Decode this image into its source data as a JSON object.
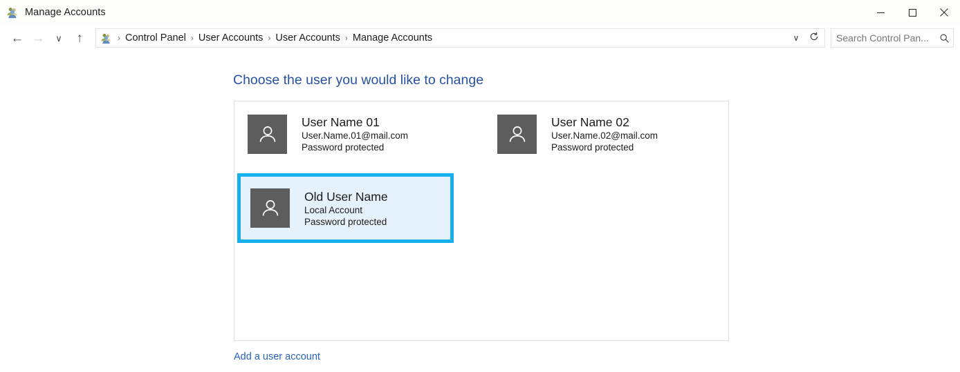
{
  "window": {
    "title": "Manage Accounts",
    "icon": "users-icon",
    "minimize_label": "–",
    "maximize_label": "□",
    "close_label": "×"
  },
  "addressbar": {
    "back_label": "←",
    "forward_label": "→",
    "recent_label": "∨",
    "up_label": "↑",
    "path_icon": "users-icon",
    "breadcrumbs": [
      {
        "label": "Control Panel"
      },
      {
        "label": "User Accounts"
      },
      {
        "label": "User Accounts"
      },
      {
        "label": "Manage Accounts"
      }
    ],
    "separator": "›",
    "dropdown_label": "∨",
    "refresh_label": "refresh-icon",
    "search": {
      "placeholder": "Search Control Pan...",
      "value": "",
      "icon": "search-icon"
    }
  },
  "main": {
    "heading": "Choose the user you would like to change",
    "accounts": [
      {
        "name": "User Name 01",
        "detail": "User.Name.01@mail.com",
        "status": "Password protected",
        "avatar": "person-avatar-icon",
        "selected": false
      },
      {
        "name": "User Name 02",
        "detail": "User.Name.02@mail.com",
        "status": "Password protected",
        "avatar": "person-avatar-icon",
        "selected": false
      },
      {
        "name": "Old User Name",
        "detail": "Local Account",
        "status": "Password protected",
        "avatar": "person-avatar-icon",
        "selected": true
      }
    ],
    "add_account_link": "Add a user account"
  },
  "colors": {
    "heading": "#27519e",
    "link": "#2a61c0",
    "selection_border": "#17b0ee",
    "selection_fill": "#e6f2fb",
    "avatar_bg": "#5d5d5d"
  }
}
